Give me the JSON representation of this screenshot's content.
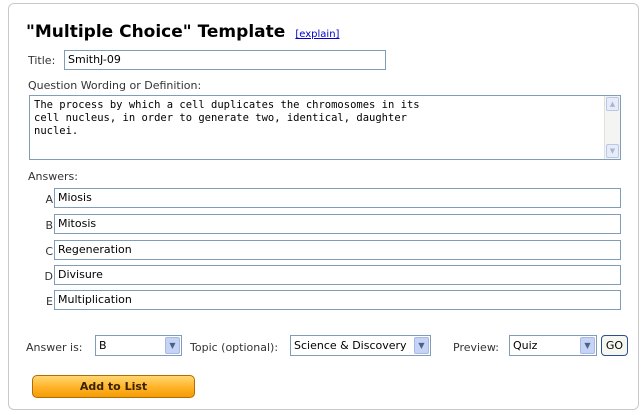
{
  "template": {
    "title": "\"Multiple Choice\" Template",
    "explain_link": "[explain]"
  },
  "title_field": {
    "label": "Title:",
    "value": "SmithJ-09"
  },
  "question": {
    "label": "Question Wording or Definition:",
    "value": "The process by which a cell duplicates the chromosomes in its\ncell nucleus, in order to generate two, identical, daughter\nnuclei."
  },
  "answers": {
    "label": "Answers:",
    "items": [
      {
        "letter": "A",
        "value": "Miosis"
      },
      {
        "letter": "B",
        "value": "Mitosis"
      },
      {
        "letter": "C",
        "value": "Regeneration"
      },
      {
        "letter": "D",
        "value": "Divisure"
      },
      {
        "letter": "E",
        "value": "Multiplication"
      }
    ]
  },
  "controls": {
    "answer_is_label": "Answer is:",
    "answer_is_value": "B",
    "topic_label": "Topic (optional):",
    "topic_value": "Science & Discovery",
    "preview_label": "Preview:",
    "preview_value": "Quiz",
    "go_label": "GO"
  },
  "add_button": {
    "label": "Add to List"
  },
  "icons": {
    "dropdown": "chevron-down-icon",
    "scroll_up": "scroll-up-icon",
    "scroll_down": "scroll-down-icon"
  },
  "colors": {
    "link": "#0000cc",
    "input_border": "#7f9db9",
    "add_button": "#ffb226"
  }
}
